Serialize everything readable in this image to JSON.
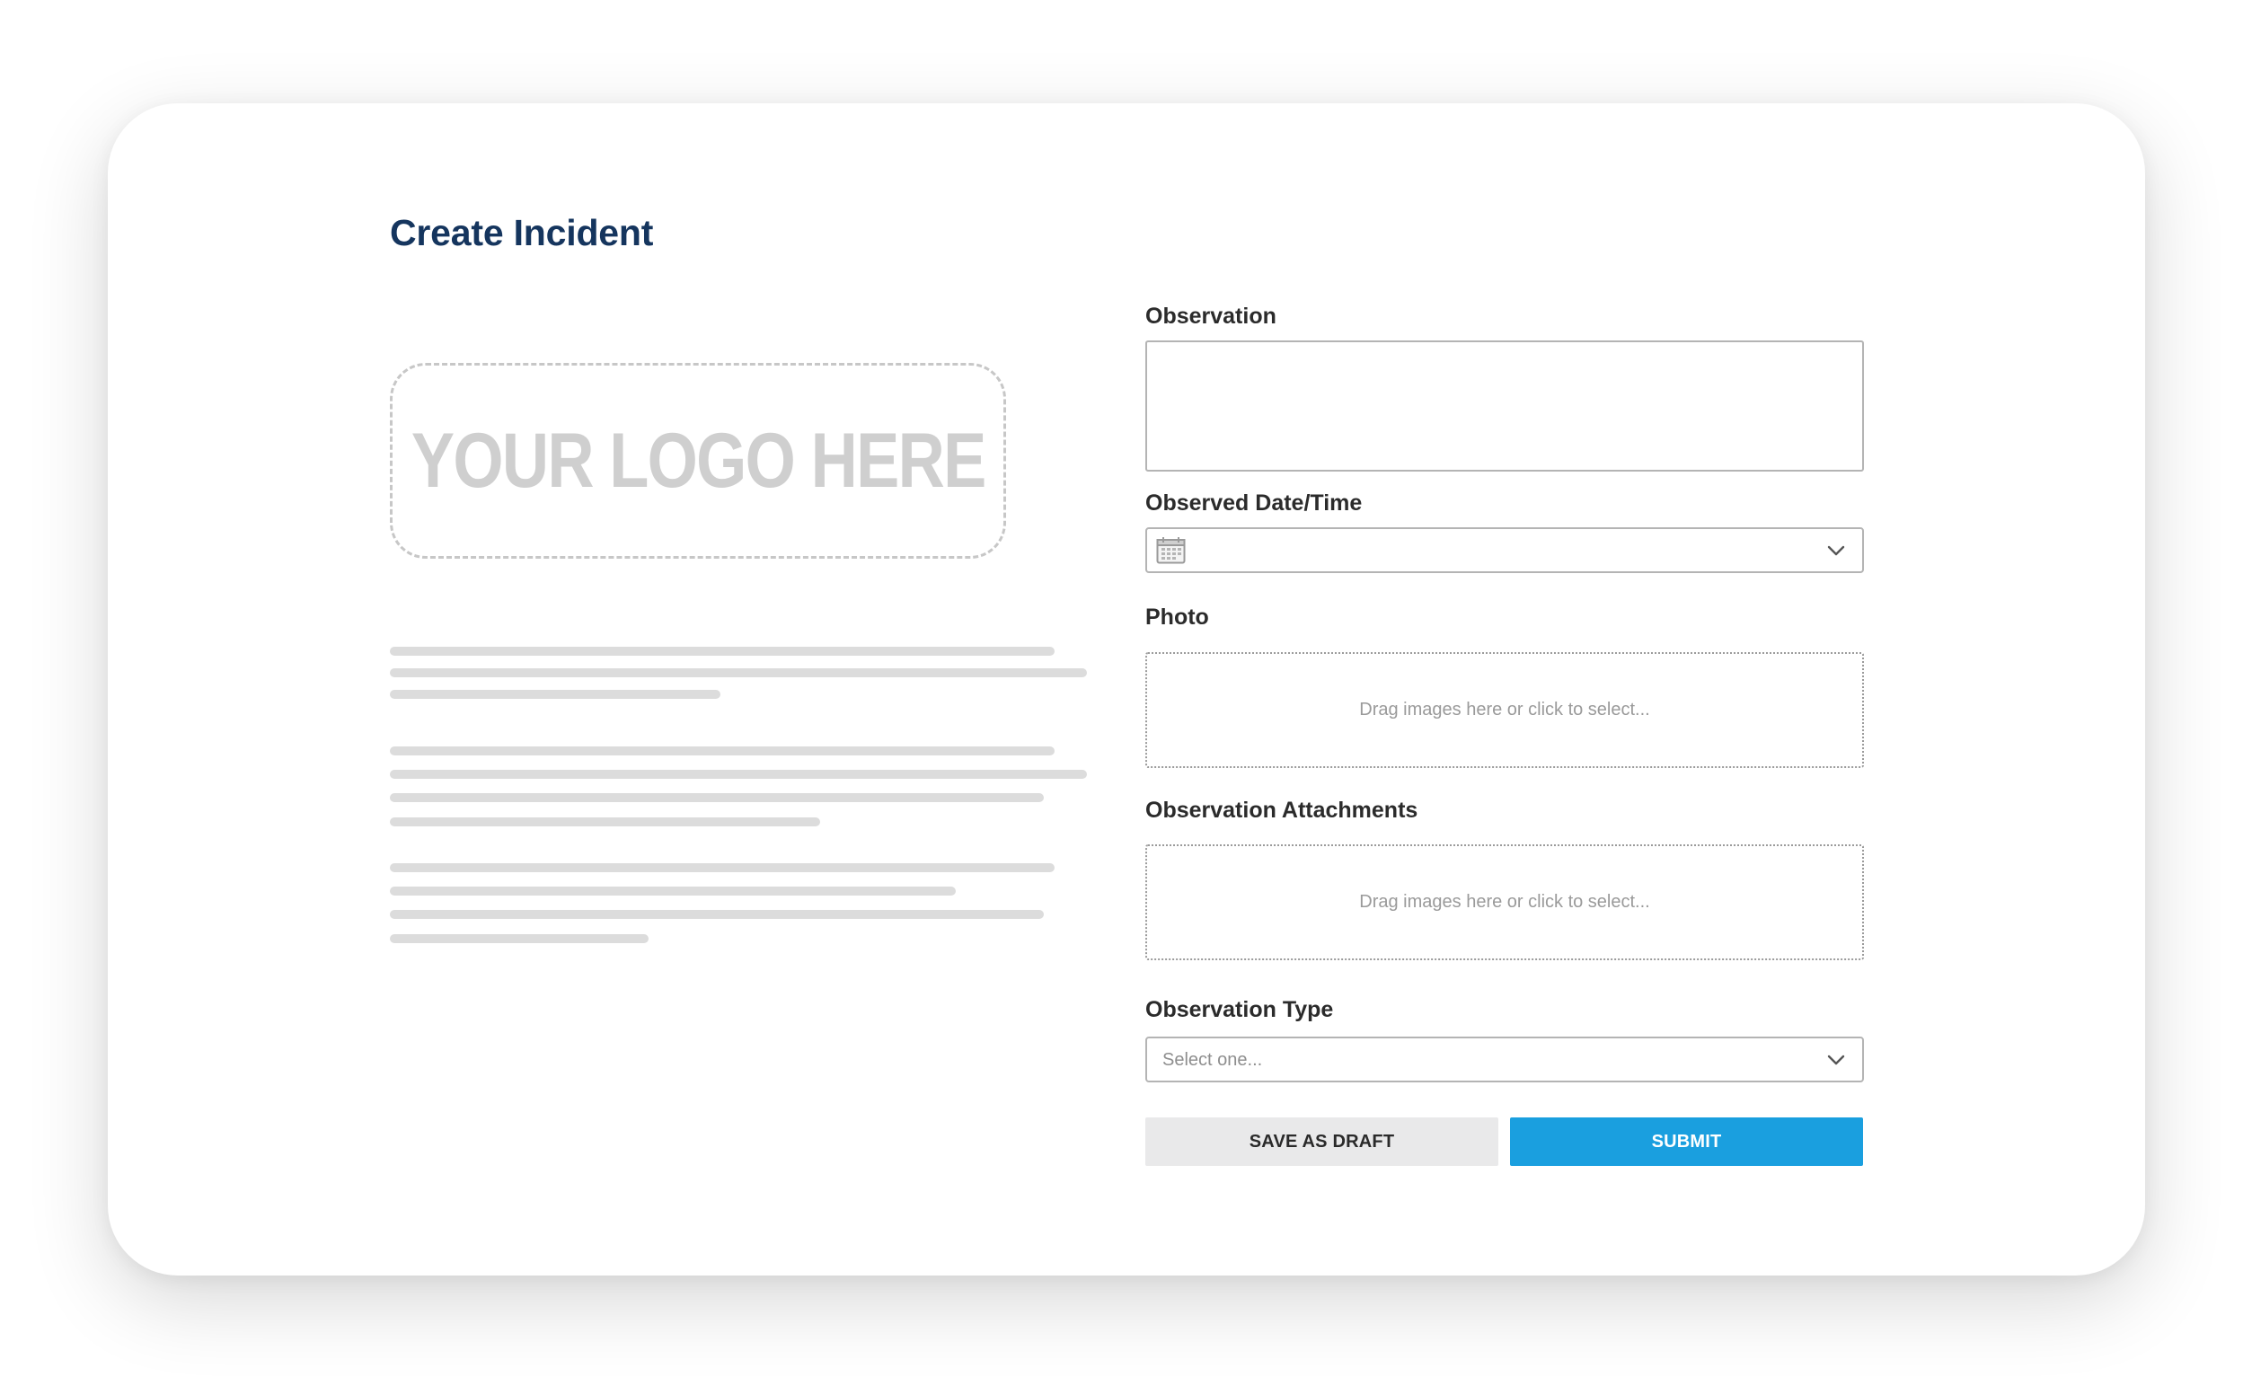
{
  "header": {
    "title": "Create Incident"
  },
  "logo": {
    "text": "YOUR LOGO HERE"
  },
  "form": {
    "observation": {
      "label": "Observation",
      "value": ""
    },
    "observed_datetime": {
      "label": "Observed Date/Time",
      "value": "",
      "icon": "calendar-icon"
    },
    "photo": {
      "label": "Photo",
      "dropzone_text": "Drag images here or click to select..."
    },
    "attachments": {
      "label": "Observation Attachments",
      "dropzone_text": "Drag images here or click to select..."
    },
    "observation_type": {
      "label": "Observation Type",
      "placeholder": "Select one..."
    }
  },
  "actions": {
    "save_draft_label": "SAVE AS DRAFT",
    "submit_label": "SUBMIT"
  },
  "colors": {
    "title": "#15355e",
    "submit": "#1a9fdf",
    "draft": "#e9e9ea",
    "placeholder_line": "#dcdcdc"
  }
}
